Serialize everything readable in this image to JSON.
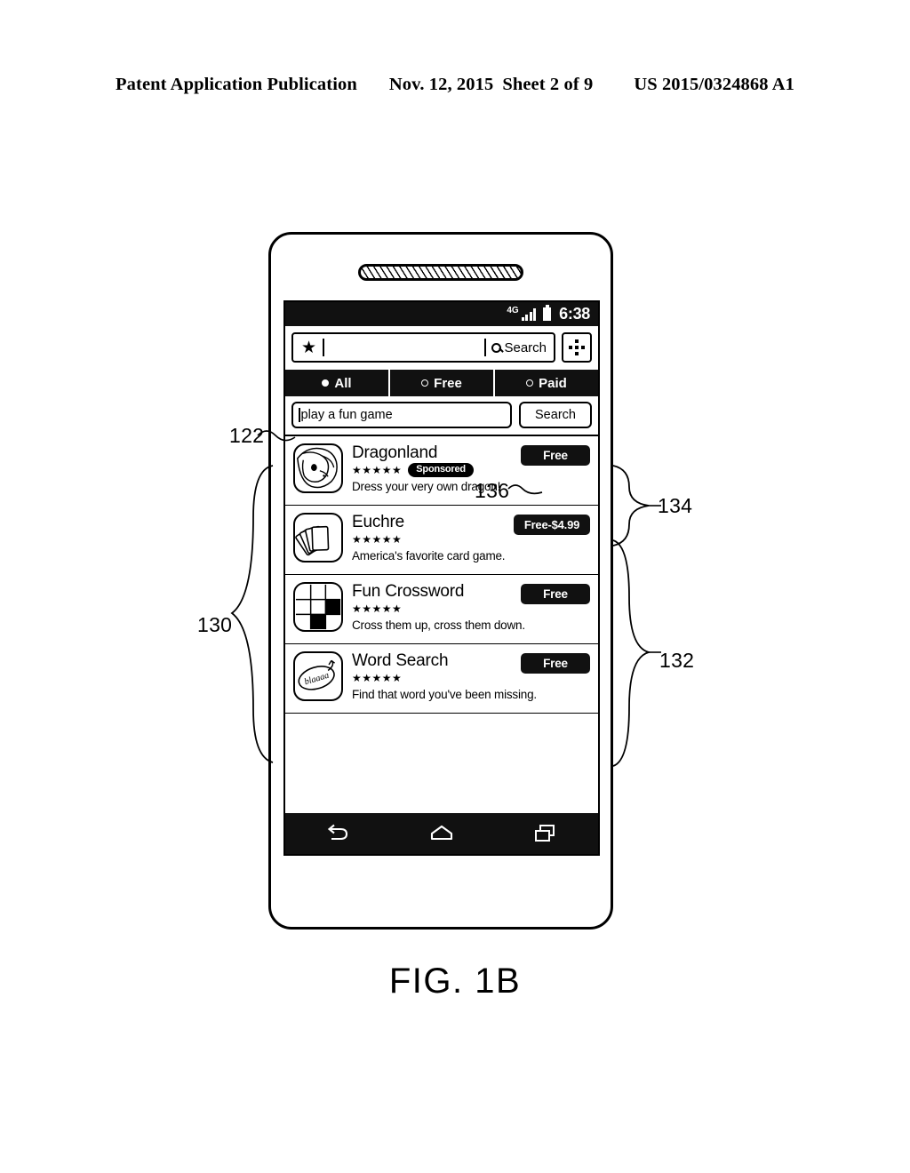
{
  "page_header": {
    "publication": "Patent Application Publication",
    "date": "Nov. 12, 2015",
    "sheet": "Sheet 2 of 9",
    "number": "US 2015/0324868 A1"
  },
  "figure_label": "FIG. 1B",
  "device": {
    "status_bar": {
      "network": "4G",
      "time": "6:38",
      "signal_icon": "signal-bars-icon",
      "battery_icon": "battery-icon"
    },
    "omnibox": {
      "star_icon": "star-icon",
      "value": "",
      "search_label": "Search",
      "search_icon": "magnifier-icon",
      "menu_icon": "dots-menu-icon"
    },
    "tabs": [
      {
        "label": "All",
        "selected": true
      },
      {
        "label": "Free",
        "selected": false
      },
      {
        "label": "Paid",
        "selected": false
      }
    ],
    "query": {
      "value": "play a fun game",
      "placeholder": "play a fun game",
      "button_label": "Search"
    },
    "results": [
      {
        "title": "Dragonland",
        "rating": "★★★★★",
        "badge": "Sponsored",
        "description": "Dress your very own dragon!",
        "price": "Free",
        "icon": "dragon-head-icon"
      },
      {
        "title": "Euchre",
        "rating": "★★★★★",
        "badge": "",
        "description": "America's favorite card game.",
        "price": "Free-$4.99",
        "icon": "playing-cards-icon"
      },
      {
        "title": "Fun Crossword",
        "rating": "★★★★★",
        "badge": "",
        "description": "Cross them up, cross them down.",
        "price": "Free",
        "icon": "crossword-grid-icon"
      },
      {
        "title": "Word Search",
        "rating": "★★★★★",
        "badge": "",
        "description": "Find that word you've been missing.",
        "price": "Free",
        "icon": "word-bubble-icon"
      }
    ],
    "nav_bar": {
      "back_icon": "back-arrow-icon",
      "home_icon": "home-icon",
      "recents_icon": "recents-icon"
    }
  },
  "reference_numerals": {
    "query_field": "122",
    "results_list": "130",
    "organic_results": "132",
    "sponsored_result": "134",
    "price_button": "136"
  },
  "word_search_icon_text": "blaaaa"
}
